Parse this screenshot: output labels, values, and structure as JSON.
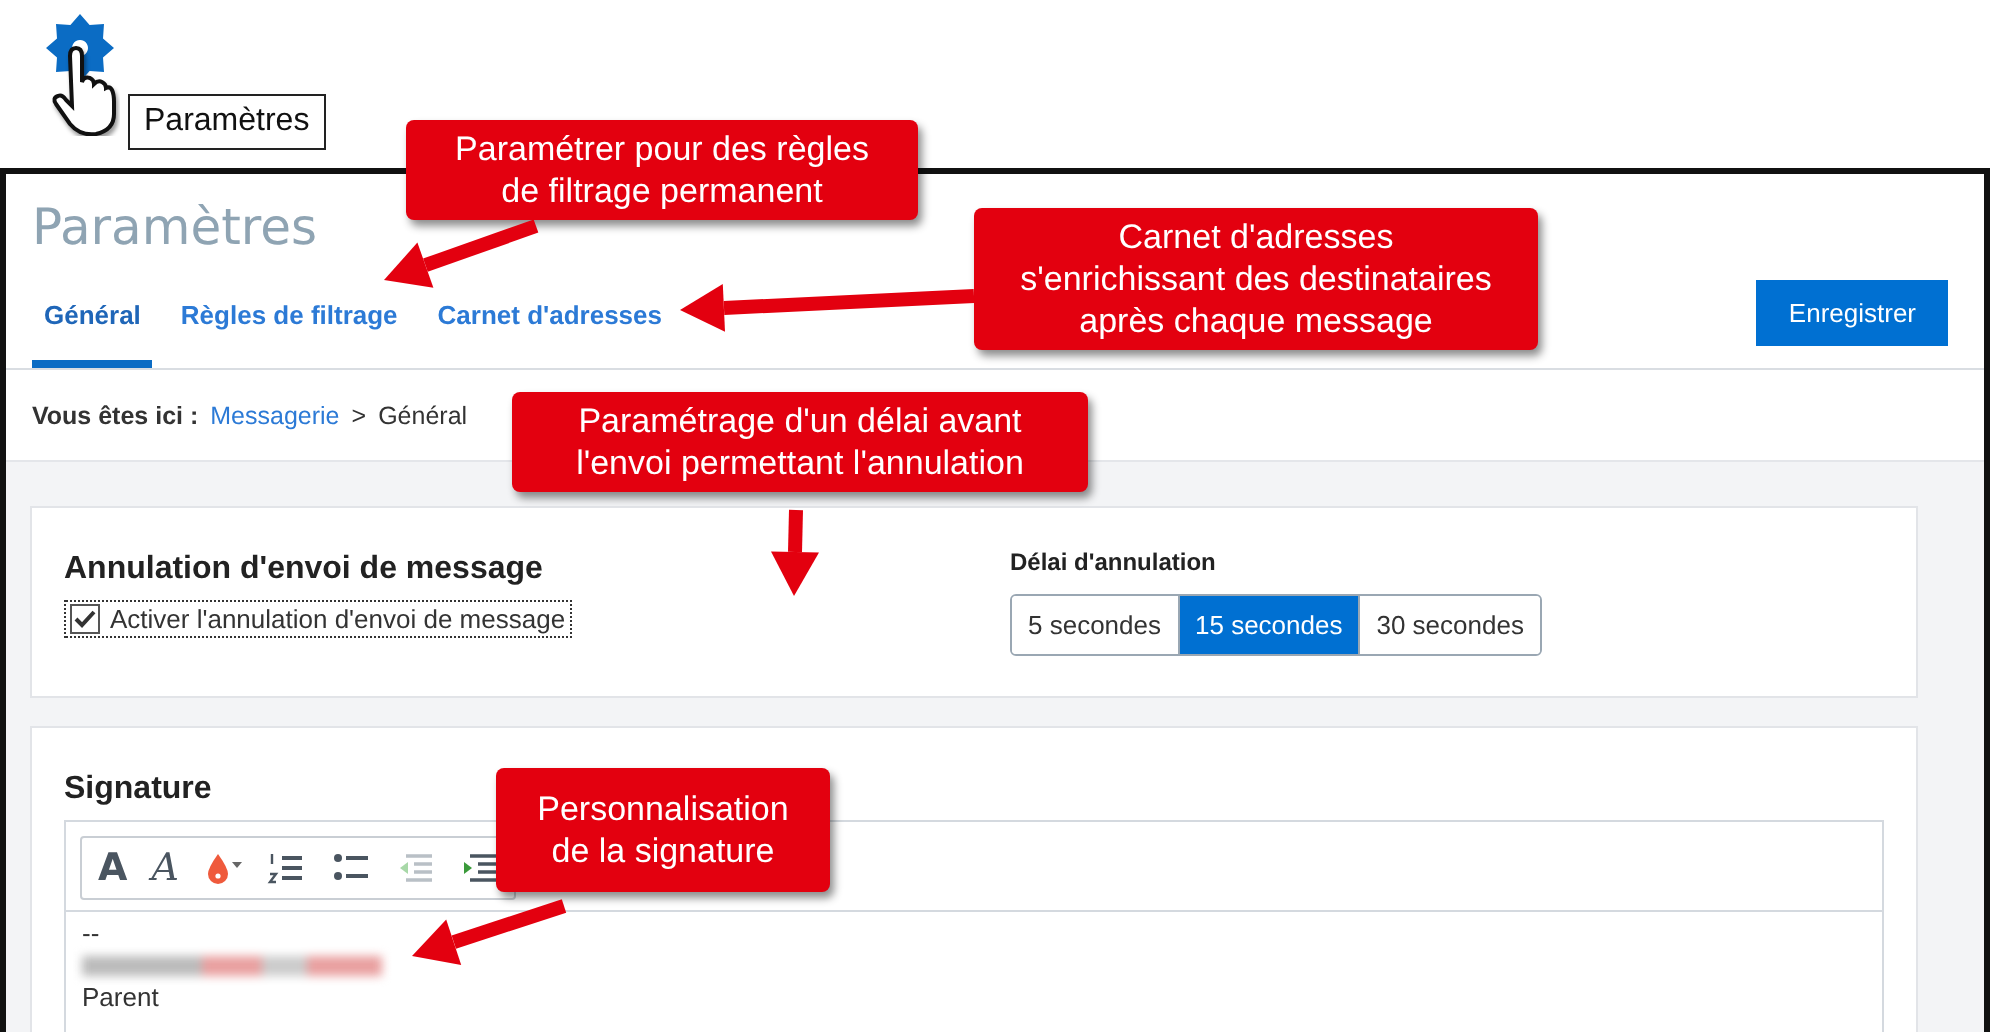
{
  "tooltip": {
    "label": "Paramètres"
  },
  "header": {
    "title": "Paramètres",
    "save_button": "Enregistrer"
  },
  "tabs": [
    {
      "label": "Général",
      "selected": true
    },
    {
      "label": "Règles de filtrage",
      "selected": false
    },
    {
      "label": "Carnet d'adresses",
      "selected": false
    }
  ],
  "breadcrumb": {
    "label": "Vous êtes ici :",
    "link": "Messagerie",
    "separator": ">",
    "current": "Général"
  },
  "cancel_send": {
    "title": "Annulation d'envoi de message",
    "checkbox": {
      "label": "Activer l'annulation d'envoi de message",
      "checked": true
    },
    "delay": {
      "label": "Délai d'annulation",
      "options": [
        {
          "label": "5 secondes",
          "selected": false
        },
        {
          "label": "15 secondes",
          "selected": true
        },
        {
          "label": "30 secondes",
          "selected": false
        }
      ]
    }
  },
  "signature": {
    "title": "Signature",
    "toolbar": [
      {
        "kind": "bold",
        "glyph": "A"
      },
      {
        "kind": "italic",
        "glyph": "A"
      },
      {
        "kind": "color"
      },
      {
        "kind": "ordered-list"
      },
      {
        "kind": "bullet-list"
      },
      {
        "kind": "outdent"
      },
      {
        "kind": "indent"
      }
    ],
    "lines": [
      {
        "kind": "text",
        "text": "--"
      },
      {
        "kind": "blurred"
      },
      {
        "kind": "text",
        "text": "Parent"
      }
    ]
  },
  "callouts": [
    {
      "text": "Paramétrer pour des règles\nde filtrage permanent"
    },
    {
      "text": "Carnet d'adresses\ns'enrichissant des destinataires\naprès chaque message"
    },
    {
      "text": "Paramétrage d'un délai avant\nl'envoi permettant l'annulation"
    },
    {
      "text": "Personnalisation\nde la signature"
    }
  ]
}
